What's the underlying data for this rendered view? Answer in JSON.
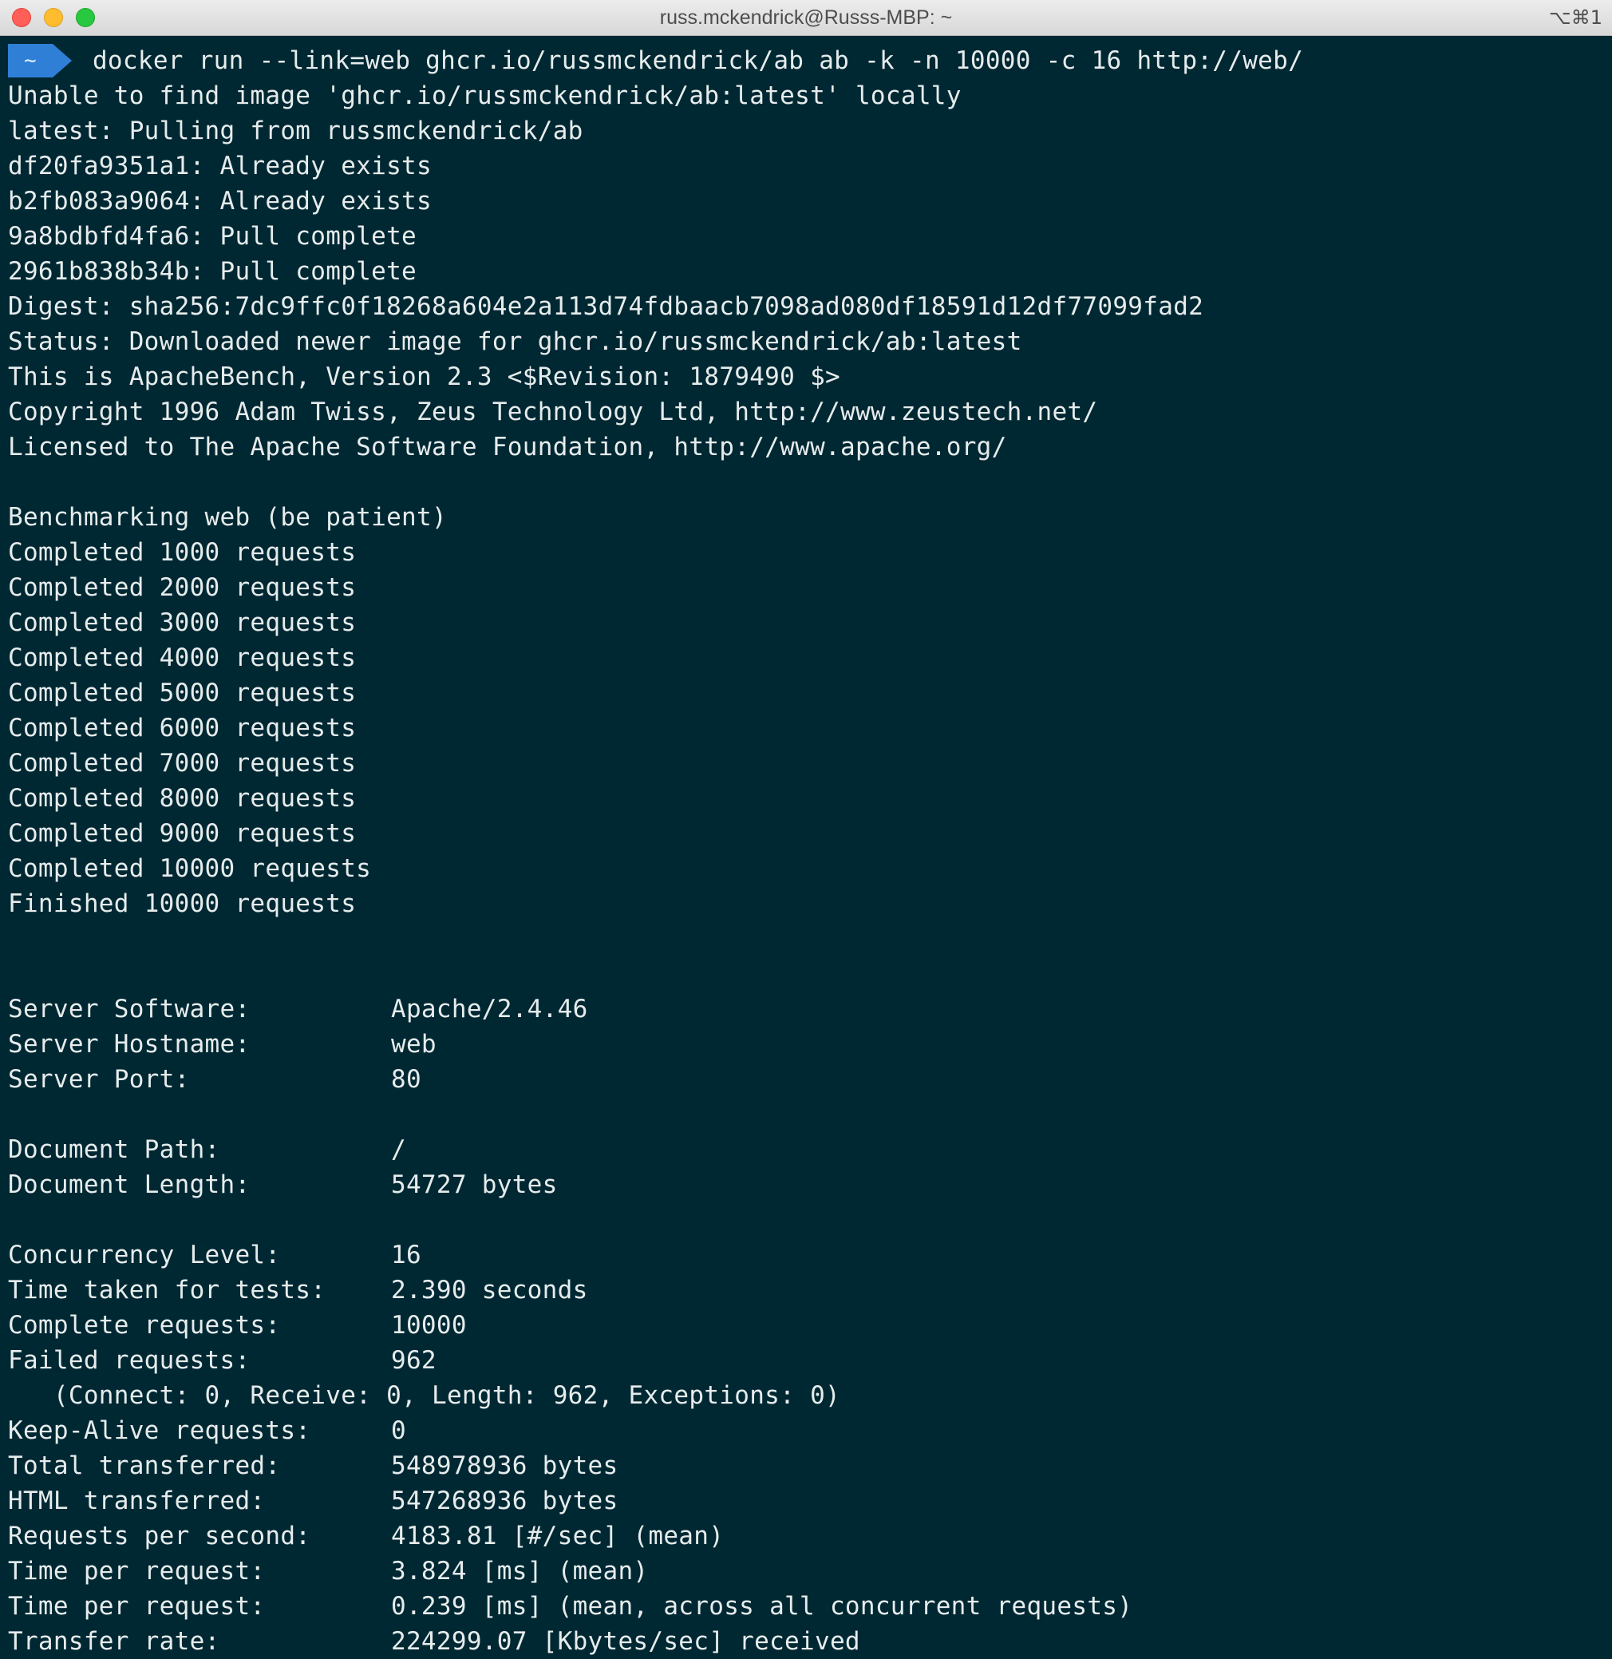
{
  "window": {
    "title": "russ.mckendrick@Russs-MBP: ~",
    "shortcut": "⌥⌘1"
  },
  "prompt": {
    "dir": "~",
    "command": "docker run --link=web ghcr.io/russmckendrick/ab ab -k -n 10000 -c 16 http://web/"
  },
  "pull_output": [
    "Unable to find image 'ghcr.io/russmckendrick/ab:latest' locally",
    "latest: Pulling from russmckendrick/ab",
    "df20fa9351a1: Already exists",
    "b2fb083a9064: Already exists",
    "9a8bdbfd4fa6: Pull complete",
    "2961b838b34b: Pull complete",
    "Digest: sha256:7dc9ffc0f18268a604e2a113d74fdbaacb7098ad080df18591d12df77099fad2",
    "Status: Downloaded newer image for ghcr.io/russmckendrick/ab:latest",
    "This is ApacheBench, Version 2.3 <$Revision: 1879490 $>",
    "Copyright 1996 Adam Twiss, Zeus Technology Ltd, http://www.zeustech.net/",
    "Licensed to The Apache Software Foundation, http://www.apache.org/"
  ],
  "progress_output": [
    "Benchmarking web (be patient)",
    "Completed 1000 requests",
    "Completed 2000 requests",
    "Completed 3000 requests",
    "Completed 4000 requests",
    "Completed 5000 requests",
    "Completed 6000 requests",
    "Completed 7000 requests",
    "Completed 8000 requests",
    "Completed 9000 requests",
    "Completed 10000 requests",
    "Finished 10000 requests"
  ],
  "server_stats": [
    {
      "key": "Server Software:",
      "value": "Apache/2.4.46"
    },
    {
      "key": "Server Hostname:",
      "value": "web"
    },
    {
      "key": "Server Port:",
      "value": "80"
    }
  ],
  "document_stats": [
    {
      "key": "Document Path:",
      "value": "/"
    },
    {
      "key": "Document Length:",
      "value": "54727 bytes"
    }
  ],
  "result_stats": [
    {
      "key": "Concurrency Level:",
      "value": "16"
    },
    {
      "key": "Time taken for tests:",
      "value": "2.390 seconds"
    },
    {
      "key": "Complete requests:",
      "value": "10000"
    },
    {
      "key": "Failed requests:",
      "value": "962"
    }
  ],
  "failed_detail": "   (Connect: 0, Receive: 0, Length: 962, Exceptions: 0)",
  "result_stats_2": [
    {
      "key": "Keep-Alive requests:",
      "value": "0"
    },
    {
      "key": "Total transferred:",
      "value": "548978936 bytes"
    },
    {
      "key": "HTML transferred:",
      "value": "547268936 bytes"
    },
    {
      "key": "Requests per second:",
      "value": "4183.81 [#/sec] (mean)"
    },
    {
      "key": "Time per request:",
      "value": "3.824 [ms] (mean)"
    },
    {
      "key": "Time per request:",
      "value": "0.239 [ms] (mean, across all concurrent requests)"
    },
    {
      "key": "Transfer rate:",
      "value": "224299.07 [Kbytes/sec] received"
    }
  ]
}
